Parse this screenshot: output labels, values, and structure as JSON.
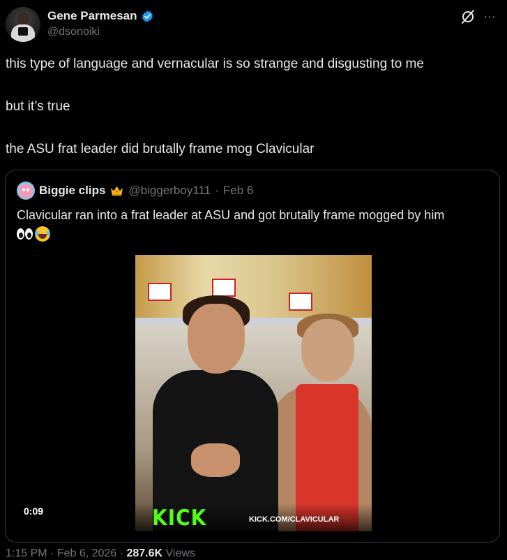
{
  "author": {
    "name": "Gene Parmesan",
    "handle": "@dsonoiki"
  },
  "tweet": {
    "lines": [
      "this type of language and vernacular is so strange and disgusting to me",
      "but it’s true",
      "the ASU frat leader did brutally frame mog Clavicular"
    ]
  },
  "quote": {
    "name": "Biggie clips",
    "handle": "@biggerboy111",
    "separator": "·",
    "date": "Feb 6",
    "text": "Clavicular ran into a frat leader at ASU and got brutally frame mogged by him",
    "video": {
      "duration": "0:09",
      "overlay_logo": "KICK",
      "overlay_url": "KICK.COM/CLAVICULAR"
    }
  },
  "meta": {
    "time": "1:15 PM",
    "date": "Feb 6, 2026",
    "views_count": "287.6K",
    "views_label": "Views"
  },
  "icons": {
    "verified": "verified-badge-icon",
    "grok": "grok-icon",
    "more": "more-icon",
    "crown": "crown-emoji-icon",
    "eyes": "eyes-emoji-icon",
    "laugh": "tears-of-joy-emoji-icon"
  },
  "colors": {
    "background": "#000000",
    "text": "#e7e9ea",
    "muted": "#71767b",
    "verified": "#1d9bf0",
    "kick_green": "#53fc18",
    "border": "#333639"
  }
}
